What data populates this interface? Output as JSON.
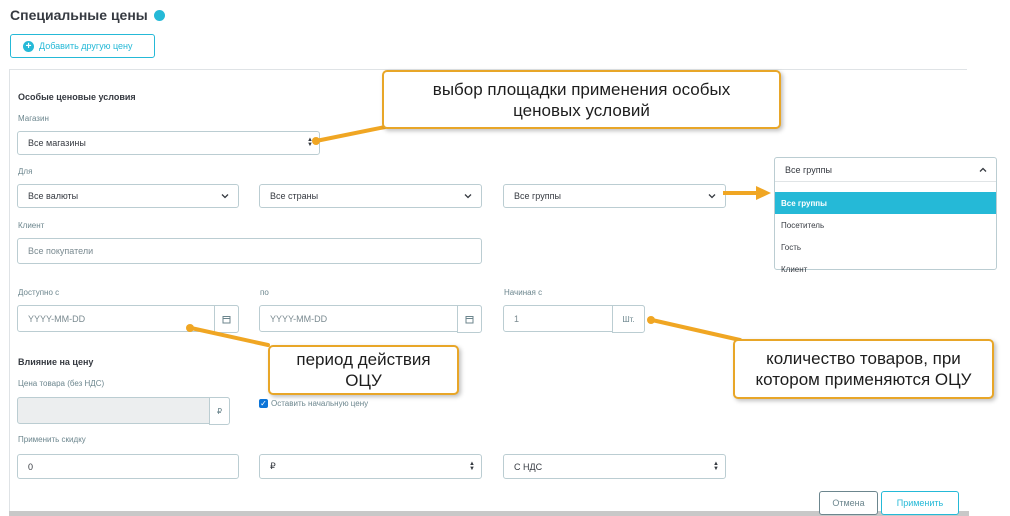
{
  "page": {
    "title": "Специальные цены",
    "add_button": "Добавить другую цену"
  },
  "conditions": {
    "heading": "Особые ценовые условия",
    "shop_label": "Магазин",
    "shop_value": "Все магазины",
    "for_label": "Для",
    "currency_value": "Все валюты",
    "country_value": "Все страны",
    "group_value": "Все группы",
    "group_dropdown": {
      "current": "Все группы",
      "options": [
        "Все группы",
        "Посетитель",
        "Гость",
        "Клиент"
      ],
      "selected_index": 0
    },
    "client_label": "Клиент",
    "client_placeholder": "Все покупатели",
    "from_label": "Доступно с",
    "from_placeholder": "YYYY-MM-DD",
    "to_label": "по",
    "to_placeholder": "YYYY-MM-DD",
    "starting_label": "Начиная с",
    "starting_value": "1",
    "starting_unit": "Шт."
  },
  "impact": {
    "heading": "Влияние на цену",
    "price_label": "Цена товара (без НДС)",
    "currency_symbol": "₽",
    "keep_price_label": "Оставить начальную цену",
    "keep_price_checked": true,
    "discount_label": "Применить скидку",
    "discount_value": "0",
    "discount_type": "₽",
    "tax_type": "С НДС"
  },
  "actions": {
    "cancel": "Отмена",
    "apply": "Применить"
  },
  "annotations": {
    "shop_callout": "выбор площадки применения особых ценовых условий",
    "period_callout": "период действия ОЦУ",
    "quantity_callout": "количество товаров, при котором применяются ОЦУ"
  },
  "colors": {
    "accent": "#25b9d7",
    "callout_border": "#e8a628",
    "arrow": "#f0a623",
    "checkbox": "#0b74d8"
  }
}
